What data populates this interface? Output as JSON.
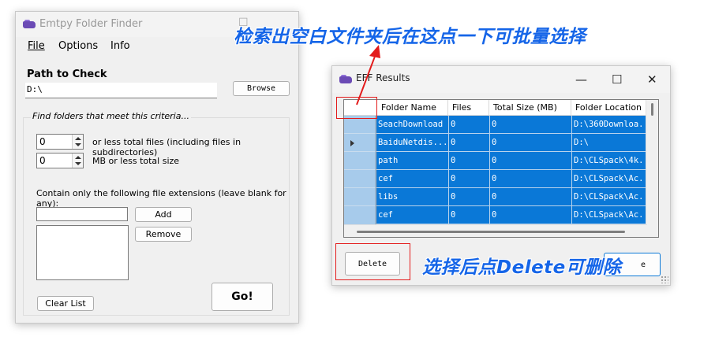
{
  "main_window": {
    "title": "Emtpy Folder Finder",
    "menu": {
      "file": "File",
      "options": "Options",
      "info": "Info"
    },
    "path_label": "Path to Check",
    "path_value": "D:\\",
    "browse_label": "Browse",
    "criteria_legend": "Find folders that meet this criteria...",
    "files_value": "0",
    "files_label": "or less total files (including files in subdirectories)",
    "size_value": "0",
    "size_label": "MB or less total size",
    "extensions_label": "Contain only the following file extensions (leave blank for any):",
    "extension_input": "",
    "add_label": "Add",
    "remove_label": "Remove",
    "clear_label": "Clear List",
    "go_label": "Go!"
  },
  "results_window": {
    "title": "EFF Results",
    "controls": {
      "minimize": "—",
      "maximize": "☐",
      "close": "✕"
    },
    "columns": [
      "Folder Name",
      "Files",
      "Total Size (MB)",
      "Folder Location"
    ],
    "rows": [
      {
        "name": "SeachDownload",
        "files": "0",
        "size": "0",
        "location": "D:\\360Downloa..."
      },
      {
        "name": "BaiduNetdis...",
        "files": "0",
        "size": "0",
        "location": "D:\\"
      },
      {
        "name": "path",
        "files": "0",
        "size": "0",
        "location": "D:\\CLSpack\\4k..."
      },
      {
        "name": "cef",
        "files": "0",
        "size": "0",
        "location": "D:\\CLSpack\\Ac..."
      },
      {
        "name": "libs",
        "files": "0",
        "size": "0",
        "location": "D:\\CLSpack\\Ac..."
      },
      {
        "name": "cef",
        "files": "0",
        "size": "0",
        "location": "D:\\CLSpack\\Ac..."
      }
    ],
    "delete_label": "Delete",
    "close_button_fragment": "e"
  },
  "annotations": {
    "top": "检索出空白文件夹后在这点一下可批量选择",
    "bottom": "选择后点Delete可删除"
  },
  "colors": {
    "selection": "#0a78d7",
    "row_header": "#a7cbeb",
    "annotation_text": "#1565e8",
    "annotation_box": "#e31b1b"
  }
}
